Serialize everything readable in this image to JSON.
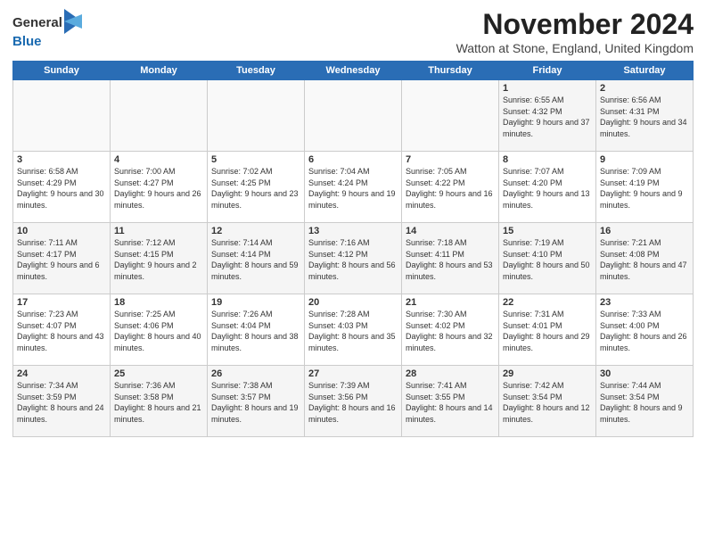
{
  "logo": {
    "general": "General",
    "blue": "Blue"
  },
  "title": "November 2024",
  "location": "Watton at Stone, England, United Kingdom",
  "days_of_week": [
    "Sunday",
    "Monday",
    "Tuesday",
    "Wednesday",
    "Thursday",
    "Friday",
    "Saturday"
  ],
  "weeks": [
    [
      {
        "day": "",
        "info": ""
      },
      {
        "day": "",
        "info": ""
      },
      {
        "day": "",
        "info": ""
      },
      {
        "day": "",
        "info": ""
      },
      {
        "day": "",
        "info": ""
      },
      {
        "day": "1",
        "info": "Sunrise: 6:55 AM\nSunset: 4:32 PM\nDaylight: 9 hours and 37 minutes."
      },
      {
        "day": "2",
        "info": "Sunrise: 6:56 AM\nSunset: 4:31 PM\nDaylight: 9 hours and 34 minutes."
      }
    ],
    [
      {
        "day": "3",
        "info": "Sunrise: 6:58 AM\nSunset: 4:29 PM\nDaylight: 9 hours and 30 minutes."
      },
      {
        "day": "4",
        "info": "Sunrise: 7:00 AM\nSunset: 4:27 PM\nDaylight: 9 hours and 26 minutes."
      },
      {
        "day": "5",
        "info": "Sunrise: 7:02 AM\nSunset: 4:25 PM\nDaylight: 9 hours and 23 minutes."
      },
      {
        "day": "6",
        "info": "Sunrise: 7:04 AM\nSunset: 4:24 PM\nDaylight: 9 hours and 19 minutes."
      },
      {
        "day": "7",
        "info": "Sunrise: 7:05 AM\nSunset: 4:22 PM\nDaylight: 9 hours and 16 minutes."
      },
      {
        "day": "8",
        "info": "Sunrise: 7:07 AM\nSunset: 4:20 PM\nDaylight: 9 hours and 13 minutes."
      },
      {
        "day": "9",
        "info": "Sunrise: 7:09 AM\nSunset: 4:19 PM\nDaylight: 9 hours and 9 minutes."
      }
    ],
    [
      {
        "day": "10",
        "info": "Sunrise: 7:11 AM\nSunset: 4:17 PM\nDaylight: 9 hours and 6 minutes."
      },
      {
        "day": "11",
        "info": "Sunrise: 7:12 AM\nSunset: 4:15 PM\nDaylight: 9 hours and 2 minutes."
      },
      {
        "day": "12",
        "info": "Sunrise: 7:14 AM\nSunset: 4:14 PM\nDaylight: 8 hours and 59 minutes."
      },
      {
        "day": "13",
        "info": "Sunrise: 7:16 AM\nSunset: 4:12 PM\nDaylight: 8 hours and 56 minutes."
      },
      {
        "day": "14",
        "info": "Sunrise: 7:18 AM\nSunset: 4:11 PM\nDaylight: 8 hours and 53 minutes."
      },
      {
        "day": "15",
        "info": "Sunrise: 7:19 AM\nSunset: 4:10 PM\nDaylight: 8 hours and 50 minutes."
      },
      {
        "day": "16",
        "info": "Sunrise: 7:21 AM\nSunset: 4:08 PM\nDaylight: 8 hours and 47 minutes."
      }
    ],
    [
      {
        "day": "17",
        "info": "Sunrise: 7:23 AM\nSunset: 4:07 PM\nDaylight: 8 hours and 43 minutes."
      },
      {
        "day": "18",
        "info": "Sunrise: 7:25 AM\nSunset: 4:06 PM\nDaylight: 8 hours and 40 minutes."
      },
      {
        "day": "19",
        "info": "Sunrise: 7:26 AM\nSunset: 4:04 PM\nDaylight: 8 hours and 38 minutes."
      },
      {
        "day": "20",
        "info": "Sunrise: 7:28 AM\nSunset: 4:03 PM\nDaylight: 8 hours and 35 minutes."
      },
      {
        "day": "21",
        "info": "Sunrise: 7:30 AM\nSunset: 4:02 PM\nDaylight: 8 hours and 32 minutes."
      },
      {
        "day": "22",
        "info": "Sunrise: 7:31 AM\nSunset: 4:01 PM\nDaylight: 8 hours and 29 minutes."
      },
      {
        "day": "23",
        "info": "Sunrise: 7:33 AM\nSunset: 4:00 PM\nDaylight: 8 hours and 26 minutes."
      }
    ],
    [
      {
        "day": "24",
        "info": "Sunrise: 7:34 AM\nSunset: 3:59 PM\nDaylight: 8 hours and 24 minutes."
      },
      {
        "day": "25",
        "info": "Sunrise: 7:36 AM\nSunset: 3:58 PM\nDaylight: 8 hours and 21 minutes."
      },
      {
        "day": "26",
        "info": "Sunrise: 7:38 AM\nSunset: 3:57 PM\nDaylight: 8 hours and 19 minutes."
      },
      {
        "day": "27",
        "info": "Sunrise: 7:39 AM\nSunset: 3:56 PM\nDaylight: 8 hours and 16 minutes."
      },
      {
        "day": "28",
        "info": "Sunrise: 7:41 AM\nSunset: 3:55 PM\nDaylight: 8 hours and 14 minutes."
      },
      {
        "day": "29",
        "info": "Sunrise: 7:42 AM\nSunset: 3:54 PM\nDaylight: 8 hours and 12 minutes."
      },
      {
        "day": "30",
        "info": "Sunrise: 7:44 AM\nSunset: 3:54 PM\nDaylight: 8 hours and 9 minutes."
      }
    ]
  ]
}
